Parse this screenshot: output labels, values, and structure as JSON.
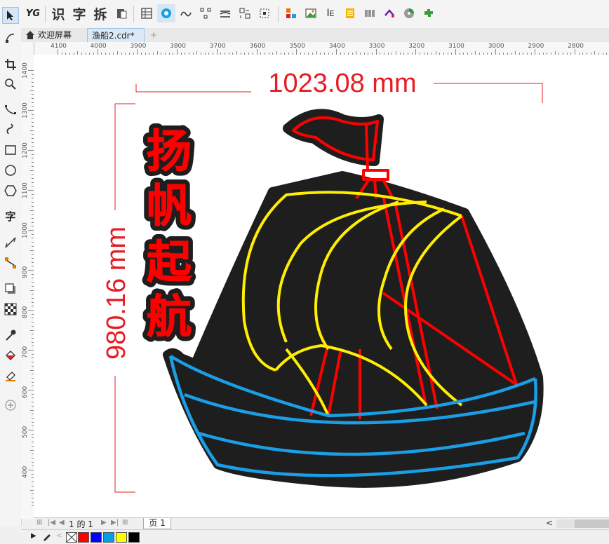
{
  "toolbar": {
    "text_recognize": "识",
    "text_char": "字",
    "text_split": "拆"
  },
  "tabs": {
    "welcome": "欢迎屏幕",
    "document": "渔船2.cdr*",
    "add": "+"
  },
  "ruler": {
    "h_labels": [
      "4100",
      "4000",
      "3900",
      "3800",
      "3700",
      "3600",
      "3500",
      "3400",
      "3300",
      "3200",
      "3100",
      "3000",
      "2900",
      "2800"
    ],
    "v_labels": [
      "1400",
      "1300",
      "1200",
      "1100",
      "1000",
      "900",
      "800",
      "700",
      "600",
      "500",
      "400"
    ]
  },
  "drawing": {
    "width_dimension": "1023.08 mm",
    "height_dimension": "980.16 mm",
    "slogan": [
      "扬",
      "帆",
      "起",
      "航"
    ],
    "colors": {
      "dimension": "#e51c23",
      "ship_body": "#1e1e1e",
      "sail_outline": "#ffee00",
      "mast_lines": "#ff0000",
      "hull_lines": "#1a9ee6"
    }
  },
  "pagenav": {
    "page_count": "1 的 1",
    "page_tab": "页 1"
  },
  "palette": {
    "colors": [
      "#ff0000",
      "#0000ff",
      "#00a0e9",
      "#ffff00",
      "#000000"
    ]
  }
}
